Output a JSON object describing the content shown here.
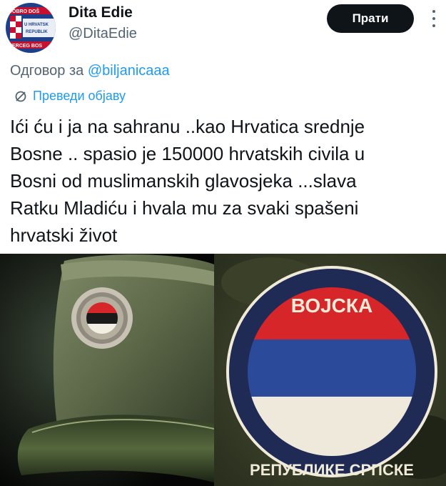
{
  "user": {
    "display_name": "Dita Edie",
    "handle": "@DitaEdie",
    "avatar_text": [
      "DOBRO DOŠ",
      "U HRVATSK",
      "REPUBLIK",
      "HERCEG BOS"
    ]
  },
  "follow_label": "Прати",
  "reply": {
    "prefix": "Одговор за ",
    "mention": "@biljanicaaa"
  },
  "translate_label": "Преведи објаву",
  "tweet_text": "Ići ću i ja na sahranu ..kao Hrvatica srednje\nBosne .. spasio je 150000 hrvatskih civila u\nBosni od muslimanskih glavosjeka ...slava\nRatku Mladiću i hvala mu za svaki spašeni\nhrvatski život",
  "patch": {
    "text_top": "ВОЈСКА",
    "text_bottom": "РЕПУБЛИКЕ СРПСКЕ"
  },
  "colors": {
    "accent": "#1d9bf0",
    "flag_red": "#d7262a",
    "flag_blue": "#2c4a9a",
    "flag_white": "#efe9dc"
  }
}
